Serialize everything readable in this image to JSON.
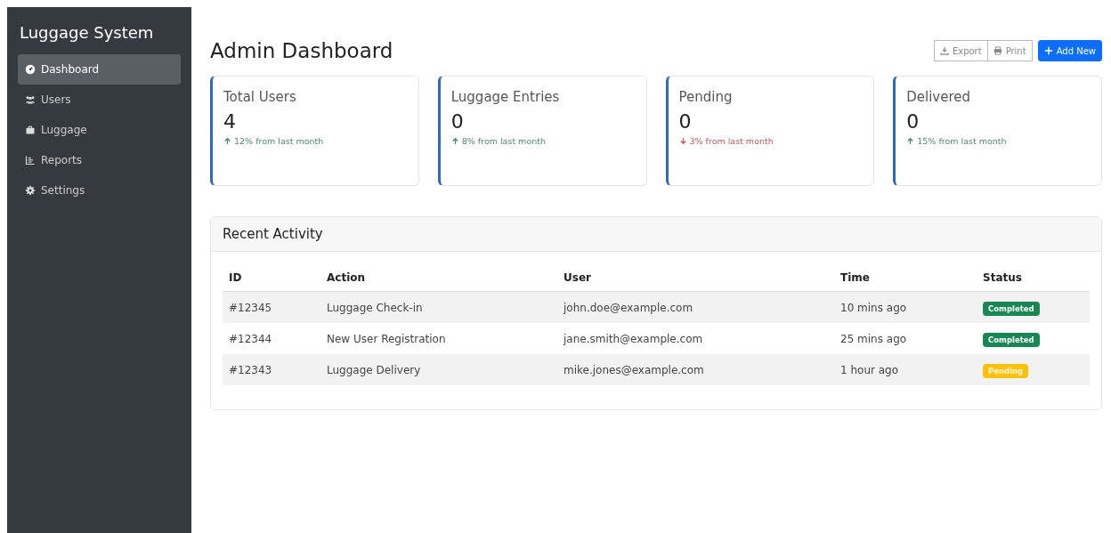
{
  "sidebar": {
    "title": "Luggage System",
    "items": [
      {
        "label": "Dashboard",
        "selected": true
      },
      {
        "label": "Users",
        "selected": false
      },
      {
        "label": "Luggage",
        "selected": false
      },
      {
        "label": "Reports",
        "selected": false
      },
      {
        "label": "Settings",
        "selected": false
      }
    ]
  },
  "header": {
    "title": "Admin Dashboard",
    "buttons": [
      {
        "label": "Export",
        "kind": "outline"
      },
      {
        "label": "Print",
        "kind": "outline"
      },
      {
        "label": "Add New",
        "kind": "primary"
      }
    ]
  },
  "stats": [
    {
      "label": "Total Users",
      "value": "4",
      "kind": "up",
      "change": "12% from last month"
    },
    {
      "label": "Luggage Entries",
      "value": "0",
      "kind": "up",
      "change": "8% from last month"
    },
    {
      "label": "Pending",
      "value": "0",
      "kind": "down",
      "change": "3% from last month"
    },
    {
      "label": "Delivered",
      "value": "0",
      "kind": "up",
      "change": "15% from last month"
    }
  ],
  "recent_activity": {
    "title": "Recent Activity",
    "columns": [
      "ID",
      "Action",
      "User",
      "Time",
      "Status"
    ],
    "rows": [
      {
        "id": "#12345",
        "action": "Luggage Check-in",
        "user": "john.doe@example.com",
        "time": "10 mins ago",
        "status": "Completed",
        "kind": "completed"
      },
      {
        "id": "#12344",
        "action": "New User Registration",
        "user": "jane.smith@example.com",
        "time": "25 mins ago",
        "status": "Completed",
        "kind": "completed"
      },
      {
        "id": "#12343",
        "action": "Luggage Delivery",
        "user": "mike.jones@example.com",
        "time": "1 hour ago",
        "status": "Pending",
        "kind": "pending"
      }
    ]
  }
}
